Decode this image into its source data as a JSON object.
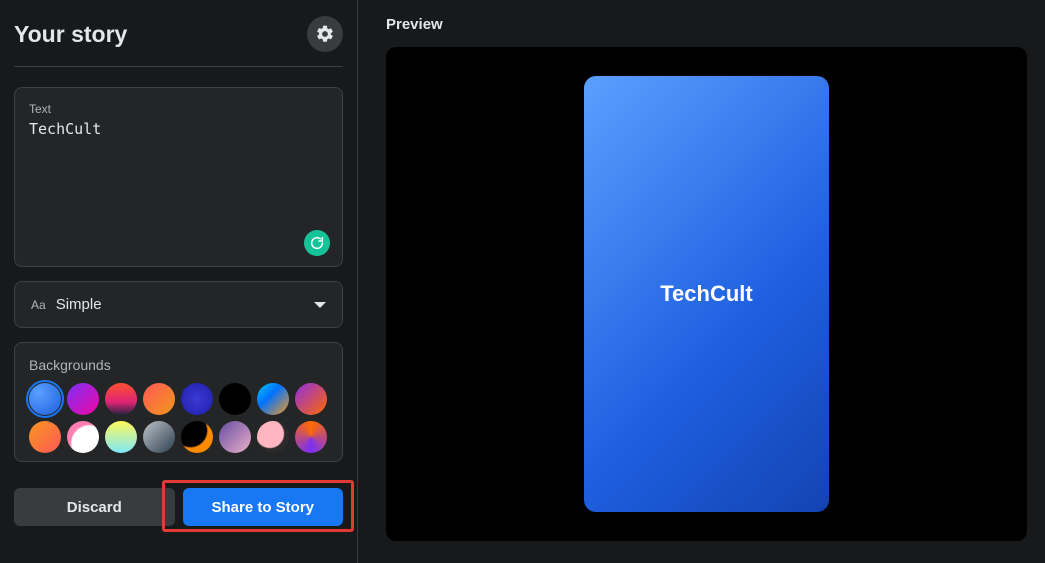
{
  "header": {
    "title": "Your story"
  },
  "text_card": {
    "label": "Text",
    "value": "TechCult"
  },
  "font_select": {
    "value": "Simple"
  },
  "backgrounds": {
    "label": "Backgrounds",
    "swatches": [
      {
        "style": "radial-gradient(circle at 30% 30%, #5aa0ff, #1e5fe0)",
        "selected": true
      },
      {
        "style": "linear-gradient(135deg,#7b2ff7,#f107a3)"
      },
      {
        "style": "linear-gradient(180deg,#ff512f,#dd2476 60%,#24243e)"
      },
      {
        "style": "linear-gradient(135deg,#ff5858,#f09819)"
      },
      {
        "style": "radial-gradient(circle,#3a3ad6,#1e1ea8)"
      },
      {
        "style": "#000000"
      },
      {
        "style": "linear-gradient(135deg,#00c6ff,#0072ff 40%,#f7971e)"
      },
      {
        "style": "linear-gradient(135deg,#8e2de2,#ff6a00)"
      },
      {
        "style": "linear-gradient(135deg,#f7971e,#ff5858)"
      },
      {
        "style": "radial-gradient(circle at 70% 70%, #ffffff 55%, #ff7eb3 60%)"
      },
      {
        "style": "linear-gradient(180deg,#fff95b,#7ee8fa)"
      },
      {
        "style": "linear-gradient(135deg,#bdc3c7,#2c3e50)"
      },
      {
        "style": "radial-gradient(circle at 30% 30%, #000 50%, #ff8a00 55%)"
      },
      {
        "style": "linear-gradient(135deg,#654ea3,#eaafc8)"
      },
      {
        "style": "radial-gradient(circle at 40% 40%, #ffb6c1 50%, #2a2a2a 55%)"
      },
      {
        "style": "conic-gradient(#ff6a00, #7b2ff7, #ff6a00)"
      }
    ]
  },
  "buttons": {
    "discard": "Discard",
    "share": "Share to Story"
  },
  "preview": {
    "label": "Preview",
    "text": "TechCult"
  }
}
